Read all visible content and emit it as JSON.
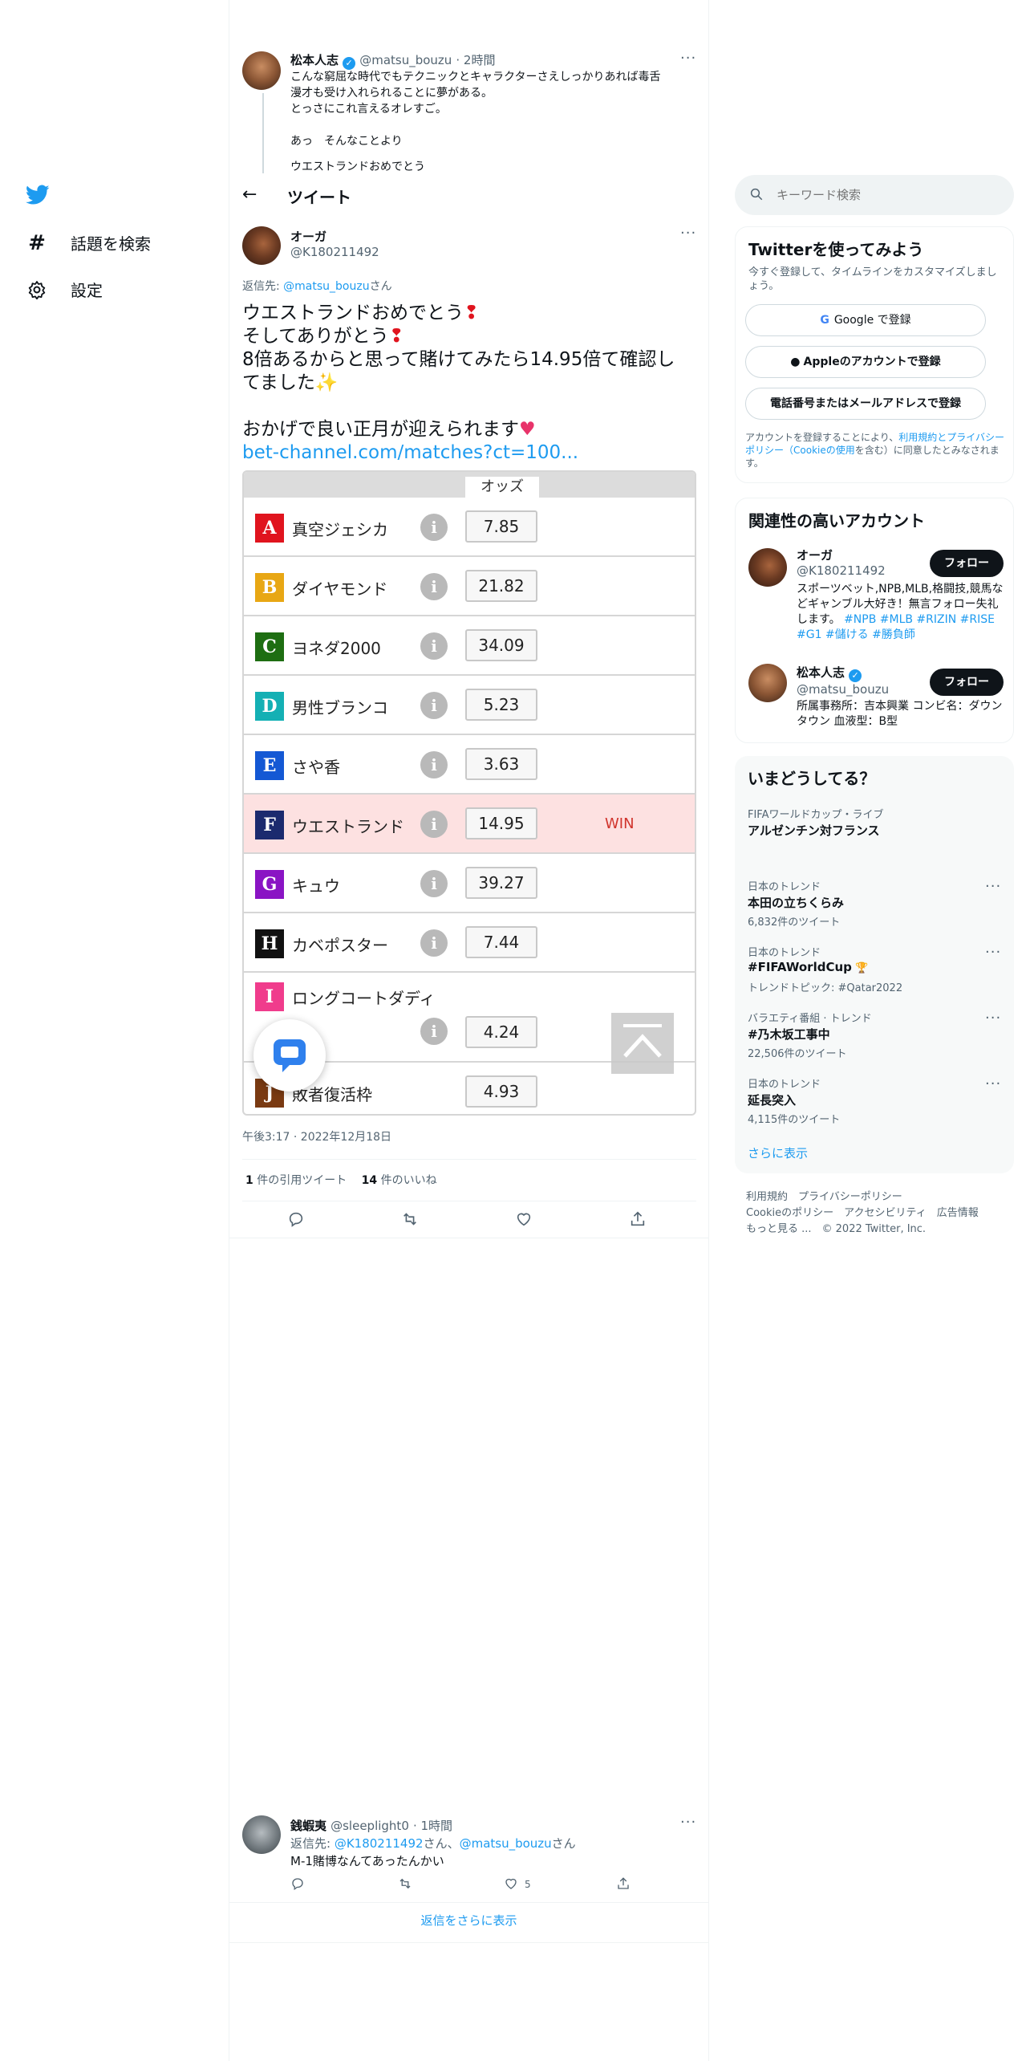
{
  "nav": {
    "explore_label": "話題を検索",
    "settings_label": "設定"
  },
  "header": {
    "title": "ツイート"
  },
  "parent_tweet": {
    "name": "松本人志",
    "handle": "@matsu_bouzu",
    "time": "· 2時間",
    "lines": [
      "こんな窮屈な時代でもテクニックとキャラクターさえしっかりあれば毒舌",
      "漫才も受け入れられることに夢がある。",
      "とっさにこれ言えるオレすご。",
      "",
      "あっ　そんなことより",
      "ウエストランドおめでとう"
    ]
  },
  "main_tweet": {
    "name": "オーガ",
    "handle": "@K180211492",
    "reply_prefix": "返信先: ",
    "reply_to": "@matsu_bouzu",
    "reply_suffix": "さん",
    "line1": "ウエストランドおめでとう",
    "line2": "そしてありがとう",
    "line3": "8倍あるからと思って賭けてみたら14.95倍て確認し",
    "line4": "てました",
    "line5": "おかげで良い正月が迎えられます",
    "link": "bet-channel.com/matches?ct=100...",
    "timestamp": "午後3:17 · 2022年12月18日",
    "quote_count": "1",
    "quote_label": "件の引用ツイート",
    "like_count": "14",
    "like_label": "件のいいね"
  },
  "odds_table": {
    "header": "オッズ",
    "win_label": "WIN",
    "rows": [
      {
        "letter": "A",
        "name": "真空ジェシカ",
        "odds": "7.85",
        "color": "#e0141e"
      },
      {
        "letter": "B",
        "name": "ダイヤモンド",
        "odds": "21.82",
        "color": "#e8a714"
      },
      {
        "letter": "C",
        "name": "ヨネダ2000",
        "odds": "34.09",
        "color": "#1e6e12"
      },
      {
        "letter": "D",
        "name": "男性ブランコ",
        "odds": "5.23",
        "color": "#14b0b4"
      },
      {
        "letter": "E",
        "name": "さや香",
        "odds": "3.63",
        "color": "#1458d4"
      },
      {
        "letter": "F",
        "name": "ウエストランド",
        "odds": "14.95",
        "color": "#1b2a6e"
      },
      {
        "letter": "G",
        "name": "キュウ",
        "odds": "39.27",
        "color": "#8a14c4"
      },
      {
        "letter": "H",
        "name": "カベポスター",
        "odds": "7.44",
        "color": "#111111"
      },
      {
        "letter": "I",
        "name": "ロングコートダディ",
        "odds": "4.24",
        "color": "#f03c8c"
      },
      {
        "letter": "J",
        "name": "敗者復活枠",
        "odds": "4.93",
        "color": "#7a3a12"
      }
    ]
  },
  "reply_tweet": {
    "name": "銭蝦夷",
    "handle": "@sleeplight0",
    "time": "· 1時間",
    "reply_prefix": "返信先: ",
    "reply_to1": "@K180211492",
    "reply_mid": "さん、",
    "reply_to2": "@matsu_bouzu",
    "reply_suffix": "さん",
    "text": "M-1賭博なんてあったんかい",
    "like_count": "5"
  },
  "show_more_replies": "返信をさらに表示",
  "sidebar": {
    "search_placeholder": "キーワード検索",
    "signup": {
      "title": "Twitterを使ってみよう",
      "desc": "今すぐ登録して、タイムラインをカスタマイズしましょう。",
      "google": "Google で登録",
      "apple": "Appleのアカウントで登録",
      "phone": "電話番号またはメールアドレスで登録",
      "terms_pre": "アカウントを登録することにより、",
      "terms_link": "利用規約とプライバシーポリシー（Cookieの使用",
      "terms_post": "を含む）に同意したとみなされます。"
    },
    "related": {
      "title": "関連性の高いアカウント",
      "accounts": [
        {
          "name": "オーガ",
          "handle": "@K180211492",
          "bio": "スポーツベット,NPB,MLB,格闘技,競馬などギャンブル大好き！無言フォロー失礼します。",
          "tags": "#NPB #MLB #RIZIN #RISE #G1 #儲ける #勝負師",
          "follow": "フォロー"
        },
        {
          "name": "松本人志",
          "handle": "@matsu_bouzu",
          "bio": "所属事務所：吉本興業 コンビ名：ダウンタウン 血液型：B型",
          "follow": "フォロー"
        }
      ]
    },
    "trends": {
      "title": "いまどうしてる？",
      "items": [
        {
          "category": "FIFAワールドカップ・ライブ",
          "name": "アルゼンチン対フランス",
          "count": ""
        },
        {
          "category": "日本のトレンド",
          "name": "本田の立ちくらみ",
          "count": "6,832件のツイート"
        },
        {
          "category": "日本のトレンド",
          "name": "#FIFAWorldCup",
          "count": "トレンドトピック: #Qatar2022"
        },
        {
          "category": "バラエティ番組 · トレンド",
          "name": "#乃木坂工事中",
          "count": "22,506件のツイート"
        },
        {
          "category": "日本のトレンド",
          "name": "延長突入",
          "count": "4,115件のツイート"
        }
      ],
      "show_more": "さらに表示"
    },
    "footer": {
      "line1": "利用規約　プライバシーポリシー",
      "line2": "Cookieのポリシー　アクセシビリティ　広告情報",
      "line3": "もっと見る ...　© 2022 Twitter, Inc."
    }
  },
  "colors": {
    "twitter_blue": "#1d9bf0",
    "win_row_bg": "#fde1e1",
    "win_text": "#d0342c"
  }
}
